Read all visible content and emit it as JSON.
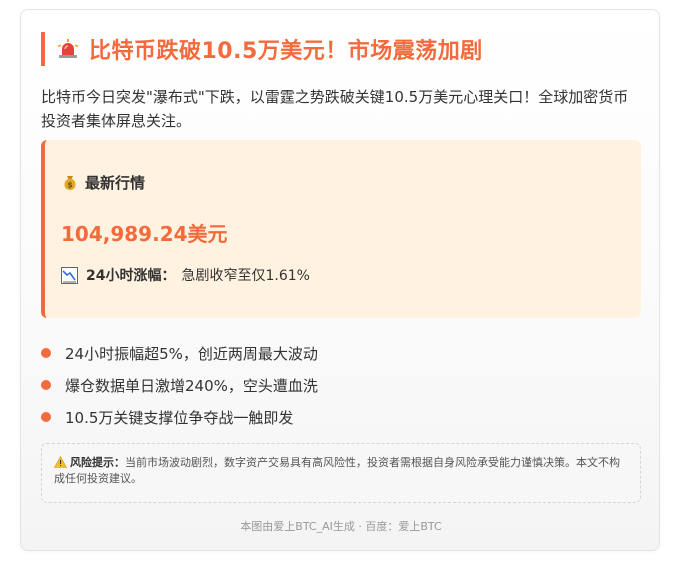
{
  "header": {
    "title": "比特币跌破10.5万美元！市场震荡加剧",
    "icon": "siren-icon",
    "accent_color": "#f36b3c"
  },
  "intro": {
    "text": "比特币今日突发\"瀑布式\"下跌，以雷霆之势跌破关键10.5万美元心理关口！全球加密货币投资者集体屏息关注。"
  },
  "market": {
    "heading": "最新行情",
    "heading_icon": "moneybag-icon",
    "price": "104,989.24美元",
    "change_icon": "chart-decreasing-icon",
    "change_label": "24小时涨幅：",
    "change_value": "急剧收窄至仅1.61%",
    "background_color": "#fff2e0"
  },
  "bullets": [
    {
      "text": "24小时振幅超5%，创近两周最大波动"
    },
    {
      "text": "爆仓数据单日激增240%，空头遭血洗"
    },
    {
      "text": "10.5万关键支撑位争夺战一触即发"
    }
  ],
  "risk": {
    "icon": "warning-icon",
    "label": "风险提示：",
    "text": "当前市场波动剧烈，数字资产交易具有高风险性，投资者需根据自身风险承受能力谨慎决策。本文不构成任何投资建议。"
  },
  "footer": {
    "text": "本图由爱上BTC_AI生成 · 百度：爱上BTC"
  }
}
